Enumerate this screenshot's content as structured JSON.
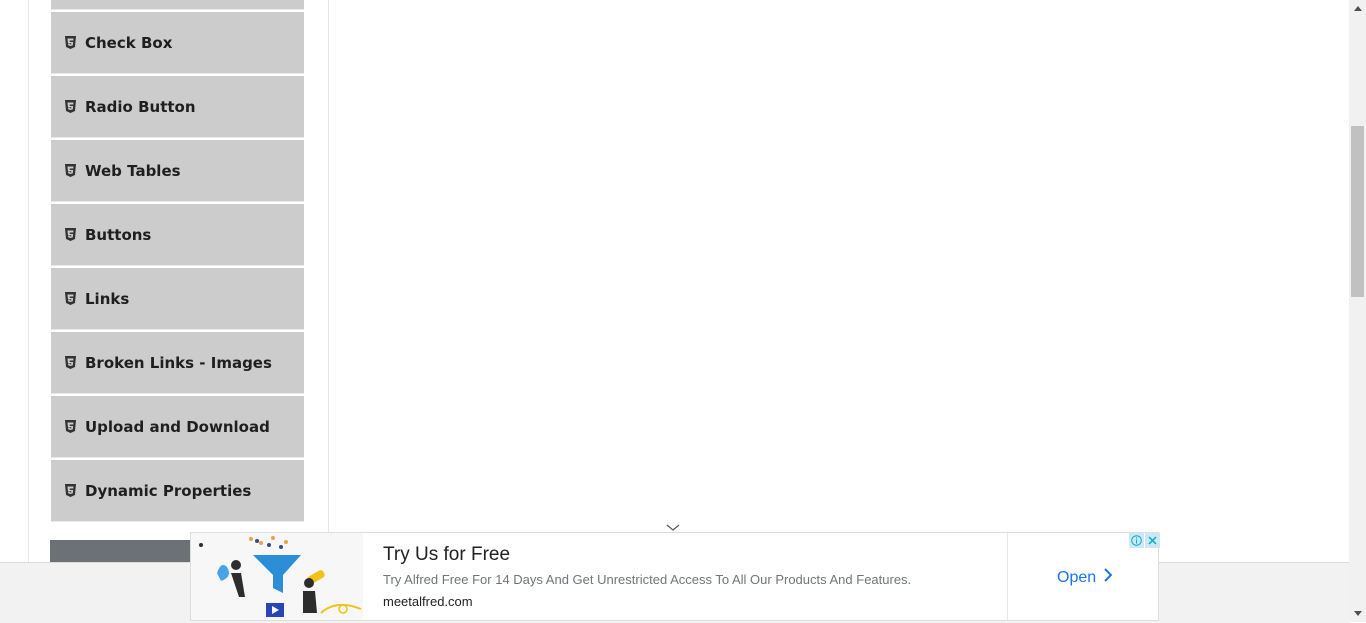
{
  "sidebar": {
    "items": [
      {
        "label": "Check Box"
      },
      {
        "label": "Radio Button"
      },
      {
        "label": "Web Tables"
      },
      {
        "label": "Buttons"
      },
      {
        "label": "Links"
      },
      {
        "label": "Broken Links - Images"
      },
      {
        "label": "Upload and Download"
      },
      {
        "label": "Dynamic Properties"
      }
    ],
    "item_icon": "html5-icon"
  },
  "ad": {
    "title": "Try Us for Free",
    "description": "Try Alfred Free For 14 Days And Get Unrestricted Access To All Our Products And Features.",
    "domain": "meetalfred.com",
    "open_label": "Open",
    "accent_color": "#1a73e8"
  },
  "colors": {
    "sidebar_item_bg": "#cccccc",
    "dark_block": "#6c7178"
  }
}
